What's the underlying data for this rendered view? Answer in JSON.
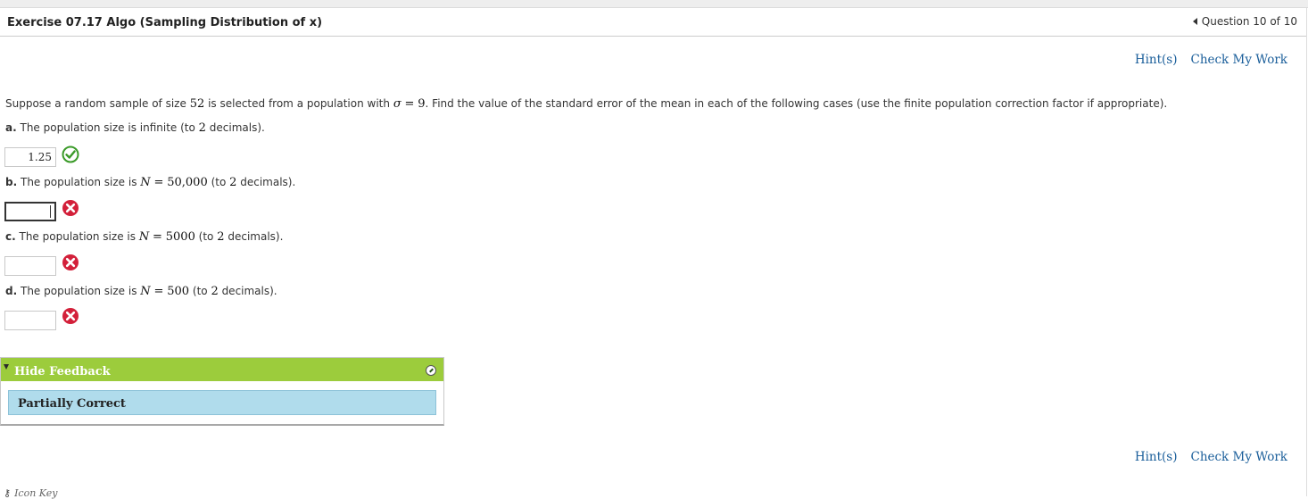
{
  "header": {
    "title": "Exercise 07.17 Algo (Sampling Distribution of x)",
    "question_nav": "Question 10 of 10"
  },
  "tools": {
    "hints": "Hint(s)",
    "check": "Check My Work"
  },
  "problem": {
    "intro_before": "Suppose a random sample of size",
    "n": "52",
    "intro_mid": "is selected from a population with",
    "sigma_sym": "σ",
    "eq": "=",
    "sigma_val": "9",
    "intro_after": ". Find the value of the standard error of the mean in each of the following cases (use the finite population correction factor if appropriate)."
  },
  "parts": [
    {
      "letter": "a.",
      "text": "The population size is infinite (to",
      "decimals": "2",
      "suffix": "decimals).",
      "answer": "1.25",
      "status": "correct"
    },
    {
      "letter": "b.",
      "text": "The population size is",
      "var": "N",
      "eq": "=",
      "N": "50,000",
      "paren": "(to",
      "decimals": "2",
      "suffix": "decimals).",
      "answer": "",
      "status": "incorrect"
    },
    {
      "letter": "c.",
      "text": "The population size is",
      "var": "N",
      "eq": "=",
      "N": "5000",
      "paren": "(to",
      "decimals": "2",
      "suffix": "decimals).",
      "answer": "",
      "status": "incorrect"
    },
    {
      "letter": "d.",
      "text": "The population size is",
      "var": "N",
      "eq": "=",
      "N": "500",
      "paren": "(to",
      "decimals": "2",
      "suffix": "decimals).",
      "answer": "",
      "status": "incorrect"
    }
  ],
  "feedback": {
    "toggle_label": "Hide Feedback",
    "status": "Partially Correct"
  },
  "footer": {
    "icon_key": "Icon Key"
  },
  "colors": {
    "correct": "#3a9a28",
    "incorrect": "#d3203a",
    "feedback_header": "#9ccc3c",
    "feedback_status": "#b0dcec",
    "link": "#1a5e9a"
  },
  "icons": [
    "question-nav-prev-icon",
    "correct-check-icon",
    "incorrect-x-icon",
    "feedback-collapse-icon",
    "feedback-edit-icon",
    "key-icon"
  ]
}
